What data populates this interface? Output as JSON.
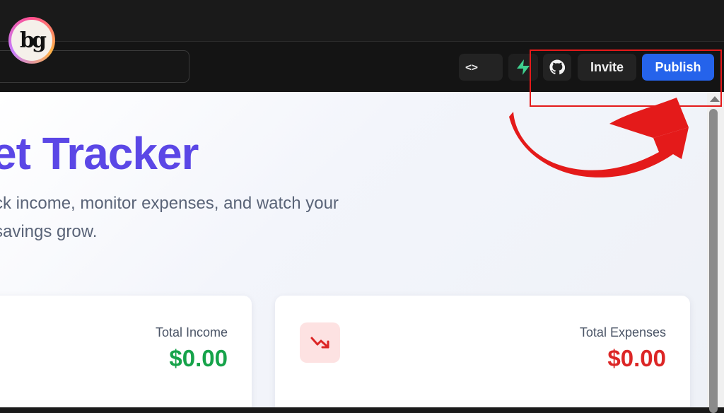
{
  "toolbar": {
    "code_label": "<>",
    "invite_label": "Invite",
    "publish_label": "Publish"
  },
  "logo": {
    "alt": "bg"
  },
  "page": {
    "title": "et Tracker",
    "subtitle": "ck income, monitor expenses, and watch your savings grow."
  },
  "cards": {
    "income": {
      "label": "Total Income",
      "value": "$0.00"
    },
    "expenses": {
      "label": "Total Expenses",
      "value": "$0.00"
    }
  },
  "icons": {
    "code": "code-icon",
    "supabase": "supabase-bolt-icon",
    "github": "github-icon",
    "trend": "trending-down-icon"
  },
  "colors": {
    "accent": "#5b47e6",
    "publish": "#2563eb",
    "income": "#16a34a",
    "expenses": "#dc2626",
    "annotation": "#e41a1a"
  }
}
